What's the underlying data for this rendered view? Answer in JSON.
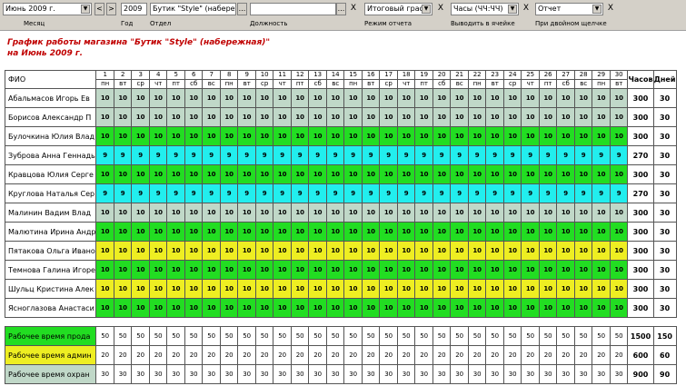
{
  "toolbar": {
    "month_value": "Июнь 2009 г.",
    "month_label": "Месяц",
    "prev_label": "<",
    "next_label": ">",
    "year_value": "2009",
    "year_label": "Год",
    "dept_value": "Бутик \"Style\" (набережна",
    "dept_label": "Отдел",
    "dots": "...",
    "position_value": "",
    "position_label": "Должность",
    "mode_value": "Итоговый графи",
    "mode_label": "Режим отчета",
    "cell_value": "Часы (ЧЧ:ЧЧ)",
    "cell_label": "Выводить в ячейке",
    "dbl_value": "Отчет",
    "dbl_label": "При двойном щелчке",
    "clear": "X"
  },
  "report": {
    "title_line1": "График работы магазина \"Бутик \"Style\" (набережная)\"",
    "title_line2": "на Июнь 2009 г."
  },
  "table": {
    "fio_header": "ФИО",
    "hours_header": "Часов",
    "days_header": "Дней",
    "day_numbers": [
      "1",
      "2",
      "3",
      "4",
      "5",
      "6",
      "7",
      "8",
      "9",
      "10",
      "11",
      "12",
      "13",
      "14",
      "15",
      "16",
      "17",
      "18",
      "19",
      "20",
      "21",
      "22",
      "23",
      "24",
      "25",
      "26",
      "27",
      "28",
      "29",
      "30"
    ],
    "weekdays": [
      "пн",
      "вт",
      "ср",
      "чт",
      "пт",
      "сб",
      "вс",
      "пн",
      "вт",
      "ср",
      "чт",
      "пт",
      "сб",
      "вс",
      "пн",
      "вт",
      "ср",
      "чт",
      "пт",
      "сб",
      "вс",
      "пн",
      "вт",
      "ср",
      "чт",
      "пт",
      "сб",
      "вс",
      "пн",
      "вт"
    ],
    "colors": {
      "gray": "#c0d8c8",
      "green": "#22dd22",
      "cyan": "#22eeee",
      "yellow": "#eeee22",
      "header_bg": "#ffffff",
      "title": "#c00000"
    },
    "employees": [
      {
        "name": "Абальмасов Игорь Ев",
        "value": "10",
        "color": "gray",
        "hours": "300",
        "days": "30"
      },
      {
        "name": "Борисов Александр П",
        "value": "10",
        "color": "gray",
        "hours": "300",
        "days": "30"
      },
      {
        "name": "Булочкина Юлия Влад",
        "value": "10",
        "color": "green",
        "hours": "300",
        "days": "30"
      },
      {
        "name": "Зуброва Анна Геннадь",
        "value": "9",
        "color": "cyan",
        "hours": "270",
        "days": "30"
      },
      {
        "name": "Кравцова Юлия Серге",
        "value": "10",
        "color": "green",
        "hours": "300",
        "days": "30"
      },
      {
        "name": "Круглова Наталья Сер",
        "value": "9",
        "color": "cyan",
        "hours": "270",
        "days": "30"
      },
      {
        "name": "Малинин Вадим Влад",
        "value": "10",
        "color": "gray",
        "hours": "300",
        "days": "30"
      },
      {
        "name": "Малютина Ирина Андр",
        "value": "10",
        "color": "green",
        "hours": "300",
        "days": "30"
      },
      {
        "name": "Пятакова Ольга Ивано",
        "value": "10",
        "color": "yellow",
        "hours": "300",
        "days": "30"
      },
      {
        "name": "Темнова Галина Игоре",
        "value": "10",
        "color": "green",
        "hours": "300",
        "days": "30"
      },
      {
        "name": "Шульц Кристина Алек",
        "value": "10",
        "color": "yellow",
        "hours": "300",
        "days": "30"
      },
      {
        "name": "Ясноглазова Анастаси",
        "value": "10",
        "color": "green",
        "hours": "300",
        "days": "30"
      }
    ],
    "summary": [
      {
        "name": "Рабочее время прода",
        "value": "50",
        "color": "green",
        "hours": "1500",
        "days": "150"
      },
      {
        "name": "Рабочее время админ",
        "value": "20",
        "color": "yellow",
        "hours": "600",
        "days": "60"
      },
      {
        "name": "Рабочее время охран",
        "value": "30",
        "color": "gray",
        "hours": "900",
        "days": "90"
      }
    ]
  }
}
